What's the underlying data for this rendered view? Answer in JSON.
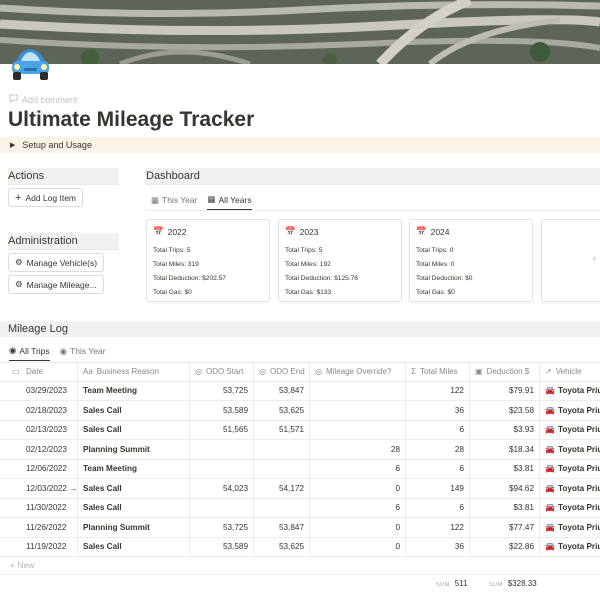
{
  "header": {
    "add_comment": "Add comment",
    "title": "Ultimate Mileage Tracker",
    "setup_toggle": "Setup and Usage"
  },
  "actions": {
    "heading": "Actions",
    "add_log_item": "Add Log Item"
  },
  "administration": {
    "heading": "Administration",
    "manage_vehicles": "Manage Vehicle(s)",
    "manage_mileage": "Manage Mileage..."
  },
  "dashboard": {
    "heading": "Dashboard",
    "tabs": [
      {
        "label": "This Year",
        "active": false
      },
      {
        "label": "All Years",
        "active": true
      }
    ],
    "cards": [
      {
        "year": "2022",
        "trips": "Total Trips: 5",
        "miles": "Total Miles: 319",
        "deduction": "Total Deduction: $202.57",
        "gas": "Total Gas: $0"
      },
      {
        "year": "2023",
        "trips": "Total Trips: 5",
        "miles": "Total Miles: 192",
        "deduction": "Total Deduction: $125.76",
        "gas": "Total Gas: $133"
      },
      {
        "year": "2024",
        "trips": "Total Trips: 0",
        "miles": "Total Miles: 0",
        "deduction": "Total Deduction: $0",
        "gas": "Total Gas: $0"
      }
    ]
  },
  "log": {
    "heading": "Mileage Log",
    "tabs": [
      {
        "label": "All Trips",
        "active": true
      },
      {
        "label": "This Year",
        "active": false
      }
    ],
    "columns": [
      "Date",
      "Business Reason",
      "ODO Start",
      "ODO End",
      "Mileage Override?",
      "Total Miles",
      "Deduction $",
      "Vehicle"
    ],
    "rows": [
      {
        "date": "03/29/2023",
        "reason": "Team Meeting",
        "odo_start": "53,725",
        "odo_end": "53,847",
        "override": "",
        "miles": "122",
        "deduction": "$79.91",
        "vehicle": "Toyota Prius"
      },
      {
        "date": "02/18/2023",
        "reason": "Sales Call",
        "odo_start": "53,589",
        "odo_end": "53,625",
        "override": "",
        "miles": "36",
        "deduction": "$23.58",
        "vehicle": "Toyota Prius"
      },
      {
        "date": "02/13/2023",
        "reason": "Sales Call",
        "odo_start": "51,565",
        "odo_end": "51,571",
        "override": "",
        "miles": "6",
        "deduction": "$3.93",
        "vehicle": "Toyota Prius"
      },
      {
        "date": "02/12/2023",
        "reason": "Planning Summit",
        "odo_start": "",
        "odo_end": "",
        "override": "28",
        "miles": "28",
        "deduction": "$18.34",
        "vehicle": "Toyota Prius"
      },
      {
        "date": "12/06/2022",
        "reason": "Team Meeting",
        "odo_start": "",
        "odo_end": "",
        "override": "6",
        "miles": "6",
        "deduction": "$3.81",
        "vehicle": "Toyota Prius"
      },
      {
        "date": "12/03/2022 →",
        "reason": "Sales Call",
        "odo_start": "54,023",
        "odo_end": "54,172",
        "override": "0",
        "miles": "149",
        "deduction": "$94.62",
        "vehicle": "Toyota Prius"
      },
      {
        "date": "11/30/2022",
        "reason": "Sales Call",
        "odo_start": "",
        "odo_end": "",
        "override": "6",
        "miles": "6",
        "deduction": "$3.81",
        "vehicle": "Toyota Prius"
      },
      {
        "date": "11/26/2022",
        "reason": "Planning Summit",
        "odo_start": "53,725",
        "odo_end": "53,847",
        "override": "0",
        "miles": "122",
        "deduction": "$77.47",
        "vehicle": "Toyota Prius"
      },
      {
        "date": "11/19/2022",
        "reason": "Sales Call",
        "odo_start": "53,589",
        "odo_end": "53,625",
        "override": "0",
        "miles": "36",
        "deduction": "$22.86",
        "vehicle": "Toyota Prius"
      }
    ],
    "new_label": "New",
    "sum_label": "SUM",
    "sum_miles": "511",
    "sum_deduction": "$328.33"
  },
  "icons": {
    "page_icon": "car-icon",
    "vehicle_icon": "car-icon",
    "button_icon": "gear-icon"
  }
}
